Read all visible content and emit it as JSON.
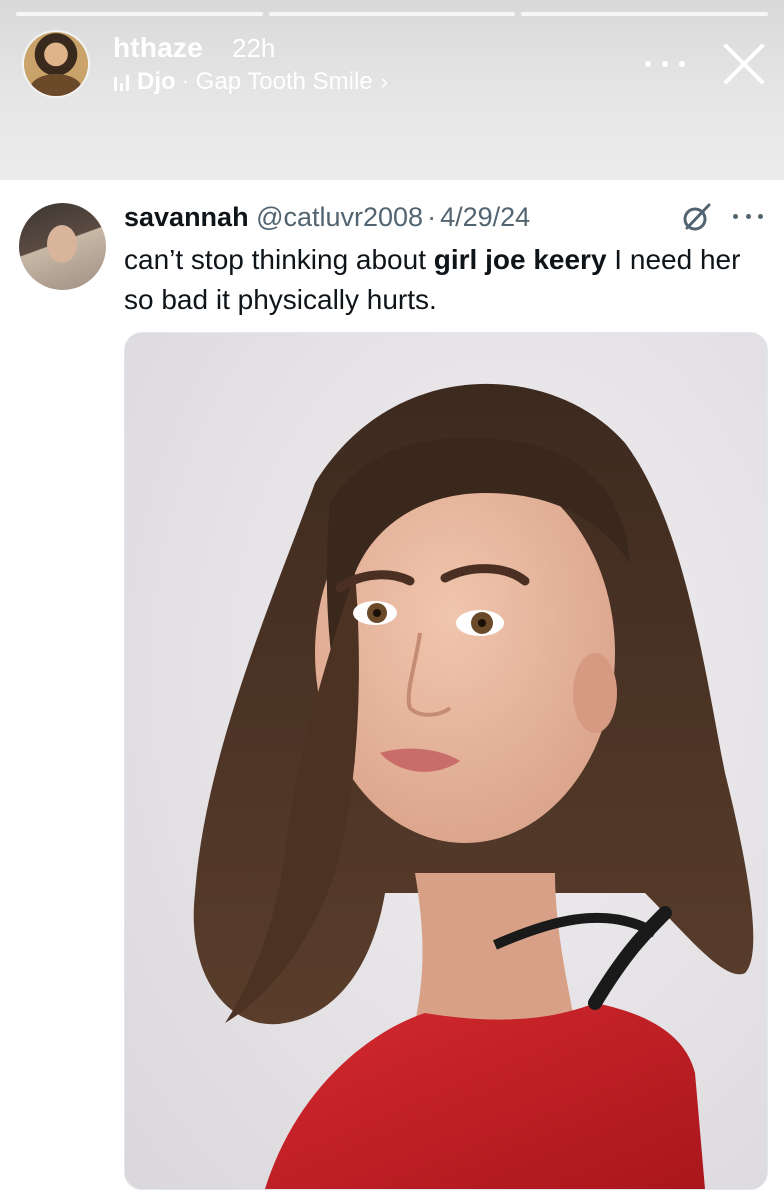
{
  "story": {
    "username": "hthaze",
    "time": "22h",
    "music": {
      "artist": "Djo",
      "separator": "·",
      "song": "Gap Tooth Smile",
      "chevron": "›"
    },
    "icons": [
      "music-bars-icon",
      "more-icon",
      "close-icon"
    ],
    "progress_segments": 3
  },
  "tweet": {
    "display_name": "savannah",
    "handle": "@catluvr2008",
    "dot": "·",
    "date": "4/29/24",
    "text_before": "can’t stop thinking about ",
    "text_bold": "girl joe keery",
    "text_after": " I need her so bad it physically hurts.",
    "icons": [
      "grok-icon",
      "more-icon"
    ]
  },
  "colors": {
    "story_header_bg": "#e3e3e3",
    "story_text": "#ffffff",
    "tweet_text": "#0f1419",
    "tweet_secondary": "#536471",
    "photo_background": "#e5e3e6",
    "hair": "#4a3325",
    "shirt": "#c62026"
  }
}
